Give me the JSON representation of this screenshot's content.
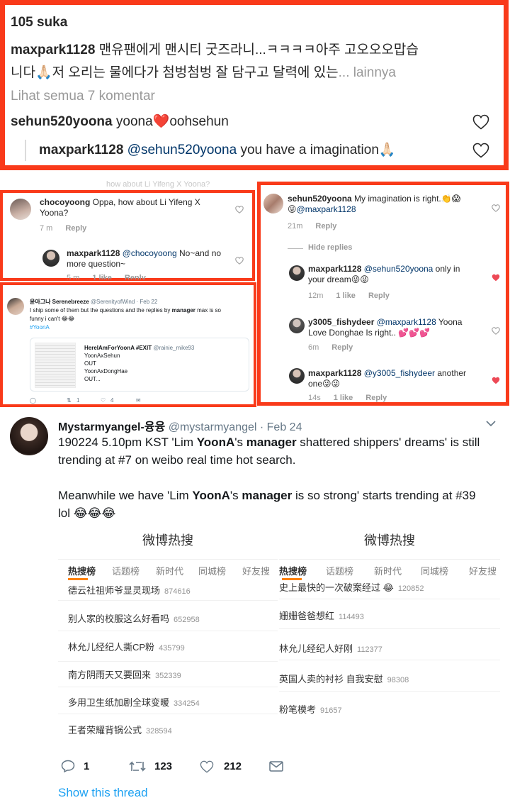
{
  "panel1": {
    "likes": "105 suka",
    "caption_user": "maxpark1128",
    "caption_line1": " 맨유팬에게 맨시티 굿즈라니...ㅋㅋㅋㅋ아주 고오오오맙습",
    "caption_line2": "니다🙏🏻저 오리는 물에다가 첨벙첨벙 잘 담구고 달력에 있는",
    "caption_more": "... lainnya",
    "view_all": "Lihat semua 7 komentar",
    "comment1_user": "sehun520yoona",
    "comment1_text_a": " yoona",
    "comment1_emoji": "❤️",
    "comment1_text_b": "oohsehun",
    "comment2_user": "maxpark1128",
    "comment2_mention": "@sehun520yoona",
    "comment2_text": " you have a  imagination🙏🏻"
  },
  "panel2": {
    "top_cut": "how about Li Yifeng X Yoona?",
    "comment1_user": "chocoyoong",
    "comment1_text": " Oppa, how about Li Yifeng X Yoona?",
    "comment1_time": "7 m",
    "comment1_reply": "Reply",
    "comment2_user": "maxpark1128",
    "comment2_mention": "@chocoyoong",
    "comment2_text": " No~and no more question~",
    "comment2_time": "5 m",
    "comment2_like": "1 like",
    "comment2_reply": "Reply"
  },
  "panel3": {
    "c1_user": "sehun520yoona",
    "c1_text": " My imagination is right.👏😱",
    "c1_text2": "😜",
    "c1_mention": "@maxpark1128",
    "c1_time": "21m",
    "c1_reply": "Reply",
    "hide_replies": "Hide replies",
    "c2_user": "maxpark1128",
    "c2_mention": "@sehun520yoona",
    "c2_text": " only in",
    "c2_text2": "your dream😜😜",
    "c2_time": "12m",
    "c2_like": "1 like",
    "c2_reply": "Reply",
    "c3_user": "y3005_fishydeer",
    "c3_mention": "@maxpark1128",
    "c3_text": " Yoona",
    "c3_text2": "Love Donghae Is right.. 💕💕💕",
    "c3_time": "6m",
    "c3_reply": "Reply",
    "c4_user": "maxpark1128",
    "c4_mention": "@y3005_fishydeer",
    "c4_text": " another",
    "c4_text2": "one😜😜",
    "c4_time": "14s",
    "c4_like": "1 like",
    "c4_reply": "Reply"
  },
  "panel4": {
    "name": "윤아그나 Serenebreeze",
    "handle": "@SerenityofWind · Feb 22",
    "text1": "I ship some of them but the questions and the replies by ",
    "text_bold": "manager",
    "text2": " max is so",
    "text3": "funny i can't 😂😂",
    "hashtag": "#YoonA",
    "quoted_name": "HereIAmForYoonA #EXIT",
    "quoted_handle": "@rainie_mike93",
    "quoted_lines": [
      "YoonAxSehun",
      "OUT",
      "YoonAxDongHae",
      "OUT..."
    ],
    "retweets": "1",
    "likes": "4"
  },
  "panel5": {
    "name": "Mystarmyangel-융융",
    "handle": "@mystarmyangel · Feb 24",
    "line1": "190224 5.10pm KST 'Lim ",
    "line1_b1": "YoonA",
    "line1_m": "'s ",
    "line1_b2": "manager",
    "line1_e": " shattered shippers' dreams' is still",
    "line2": "trending at #7 on weibo real time hot search.",
    "line3": "Meanwhile we have 'Lim ",
    "line3_b1": "YoonA",
    "line3_m": "'s ",
    "line3_b2": "manager",
    "line3_e": " is so strong' starts trending at #39",
    "line4": "lol 😂😂😂",
    "replies": "1",
    "retweets": "123",
    "likes": "212",
    "show_thread": "Show this thread",
    "weibo_left": {
      "title": "微博热搜",
      "tabs": [
        "热搜榜",
        "话题榜",
        "新时代",
        "同城榜",
        "好友搜"
      ],
      "rows": [
        {
          "text": "德云社祖师爷显灵现场",
          "num": "874616"
        },
        {
          "text": "别人家的校服这么好看吗",
          "num": "652958"
        },
        {
          "text": "林允儿经纪人撕CP粉",
          "num": "435799"
        },
        {
          "text": "南方阴雨天又要回来",
          "num": "352339"
        },
        {
          "text": "多用卫生纸加剧全球变暖",
          "num": "334254"
        },
        {
          "text": "王者荣耀背锅公式",
          "num": "328594"
        }
      ]
    },
    "weibo_right": {
      "title": "微博热搜",
      "tabs": [
        "热搜榜",
        "话题榜",
        "新时代",
        "同城榜",
        "好友搜"
      ],
      "rows": [
        {
          "text": "史上最快的一次破案经过 😂",
          "num": "120852"
        },
        {
          "text": "姗姗爸爸想红",
          "num": "114493"
        },
        {
          "text": "林允儿经纪人好刚",
          "num": "112377"
        },
        {
          "text": "英国人卖的衬衫 自我安慰",
          "num": "98308"
        },
        {
          "text": "粉笔模考",
          "num": "91657"
        }
      ]
    }
  },
  "colors": {
    "frame": "#f93a1a",
    "liked_heart": "#ed4956",
    "twitter_blue": "#1da1f2",
    "ig_mention": "#003569"
  }
}
